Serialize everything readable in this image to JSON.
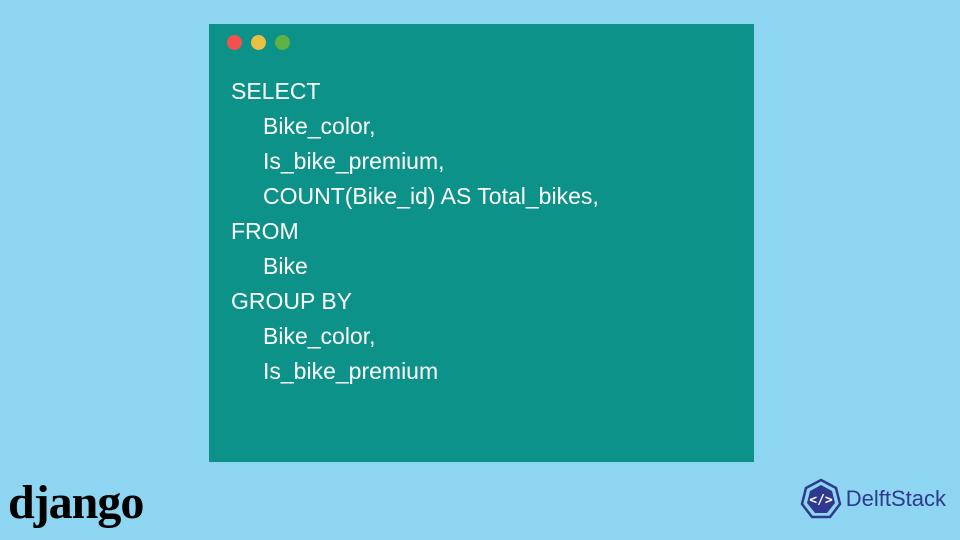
{
  "code": {
    "lines": [
      {
        "text": "SELECT",
        "indent": false
      },
      {
        "text": "Bike_color,",
        "indent": true
      },
      {
        "text": "Is_bike_premium,",
        "indent": true
      },
      {
        "text": "COUNT(Bike_id) AS Total_bikes,",
        "indent": true
      },
      {
        "text": "FROM",
        "indent": false
      },
      {
        "text": "Bike",
        "indent": true
      },
      {
        "text": "GROUP BY",
        "indent": false
      },
      {
        "text": "Bike_color,",
        "indent": true
      },
      {
        "text": "Is_bike_premium",
        "indent": true
      }
    ]
  },
  "logos": {
    "django": "django",
    "delft": "DelftStack"
  },
  "colors": {
    "window_bg": "#0d9289",
    "page_bg": "#8dd5f0",
    "dot_red": "#f2524f",
    "dot_yellow": "#e9c043",
    "dot_green": "#5db245",
    "delft_blue": "#2f3a8f"
  }
}
